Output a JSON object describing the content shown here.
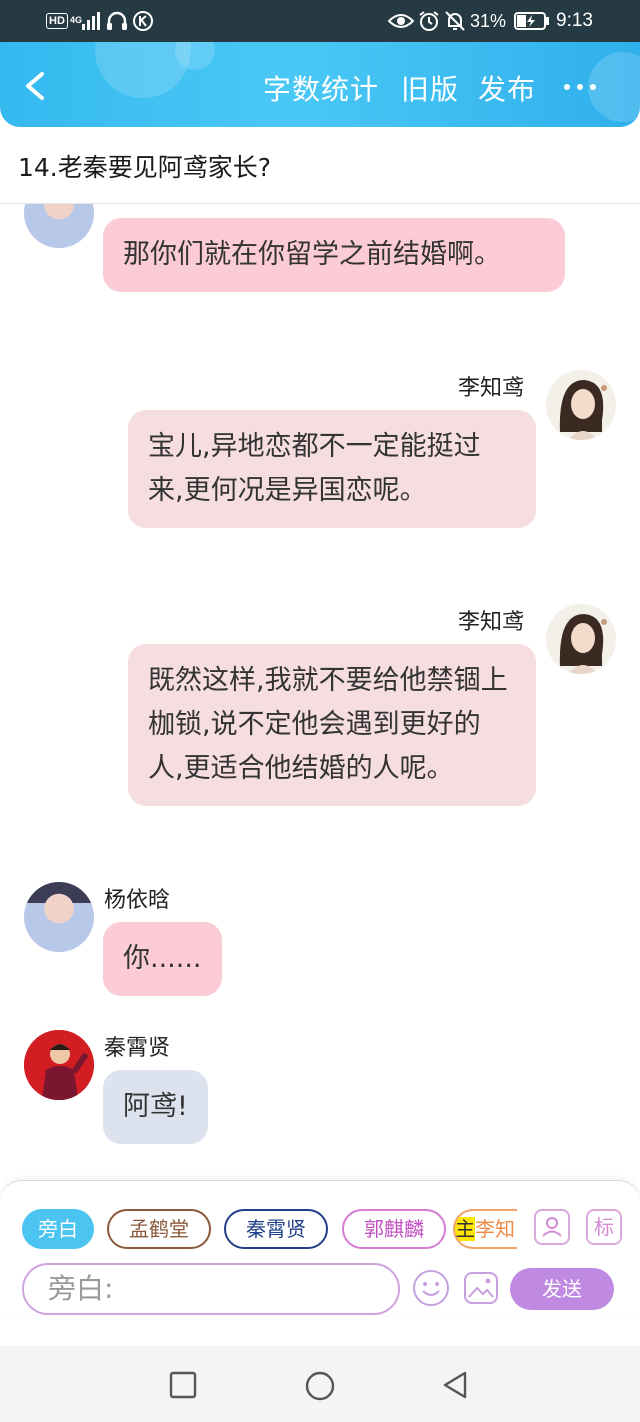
{
  "status_bar": {
    "hd_badge": "HD",
    "network_type": "4G",
    "battery_percent": "31%",
    "time": "9:13"
  },
  "header": {
    "actions": {
      "word_count": "字数统计",
      "old_version": "旧版",
      "publish": "发布"
    }
  },
  "chapter": {
    "title": "14.老秦要见阿鸢家长?"
  },
  "messages": [
    {
      "side": "left",
      "sender": "",
      "text": "那你们就在你留学之前结婚啊。"
    },
    {
      "side": "right",
      "sender": "李知鸢",
      "text": "宝儿,异地恋都不一定能挺过来,更何况是异国恋呢。"
    },
    {
      "side": "right",
      "sender": "李知鸢",
      "text": "既然这样,我就不要给他禁锢上枷锁,说不定他会遇到更好的人,更适合他结婚的人呢。"
    },
    {
      "side": "left",
      "sender": "杨依晗",
      "text": "你......"
    },
    {
      "side": "left",
      "sender": "秦霄贤",
      "text": "阿鸢!"
    }
  ],
  "toolbar": {
    "roles": {
      "narration": "旁白",
      "meng": "孟鹤堂",
      "qin": "秦霄贤",
      "guo": "郭麒麟",
      "li_main_mark": "主",
      "li": "李知"
    },
    "tag_button": "标",
    "input_placeholder": "旁白:",
    "send": "发送"
  },
  "colors": {
    "header_blue": "#34b9ef",
    "bubble_pink": "#fcccd6",
    "bubble_rose": "#f5dde0",
    "bubble_gray": "#dde3ee",
    "send_purple": "#c08ae2"
  }
}
